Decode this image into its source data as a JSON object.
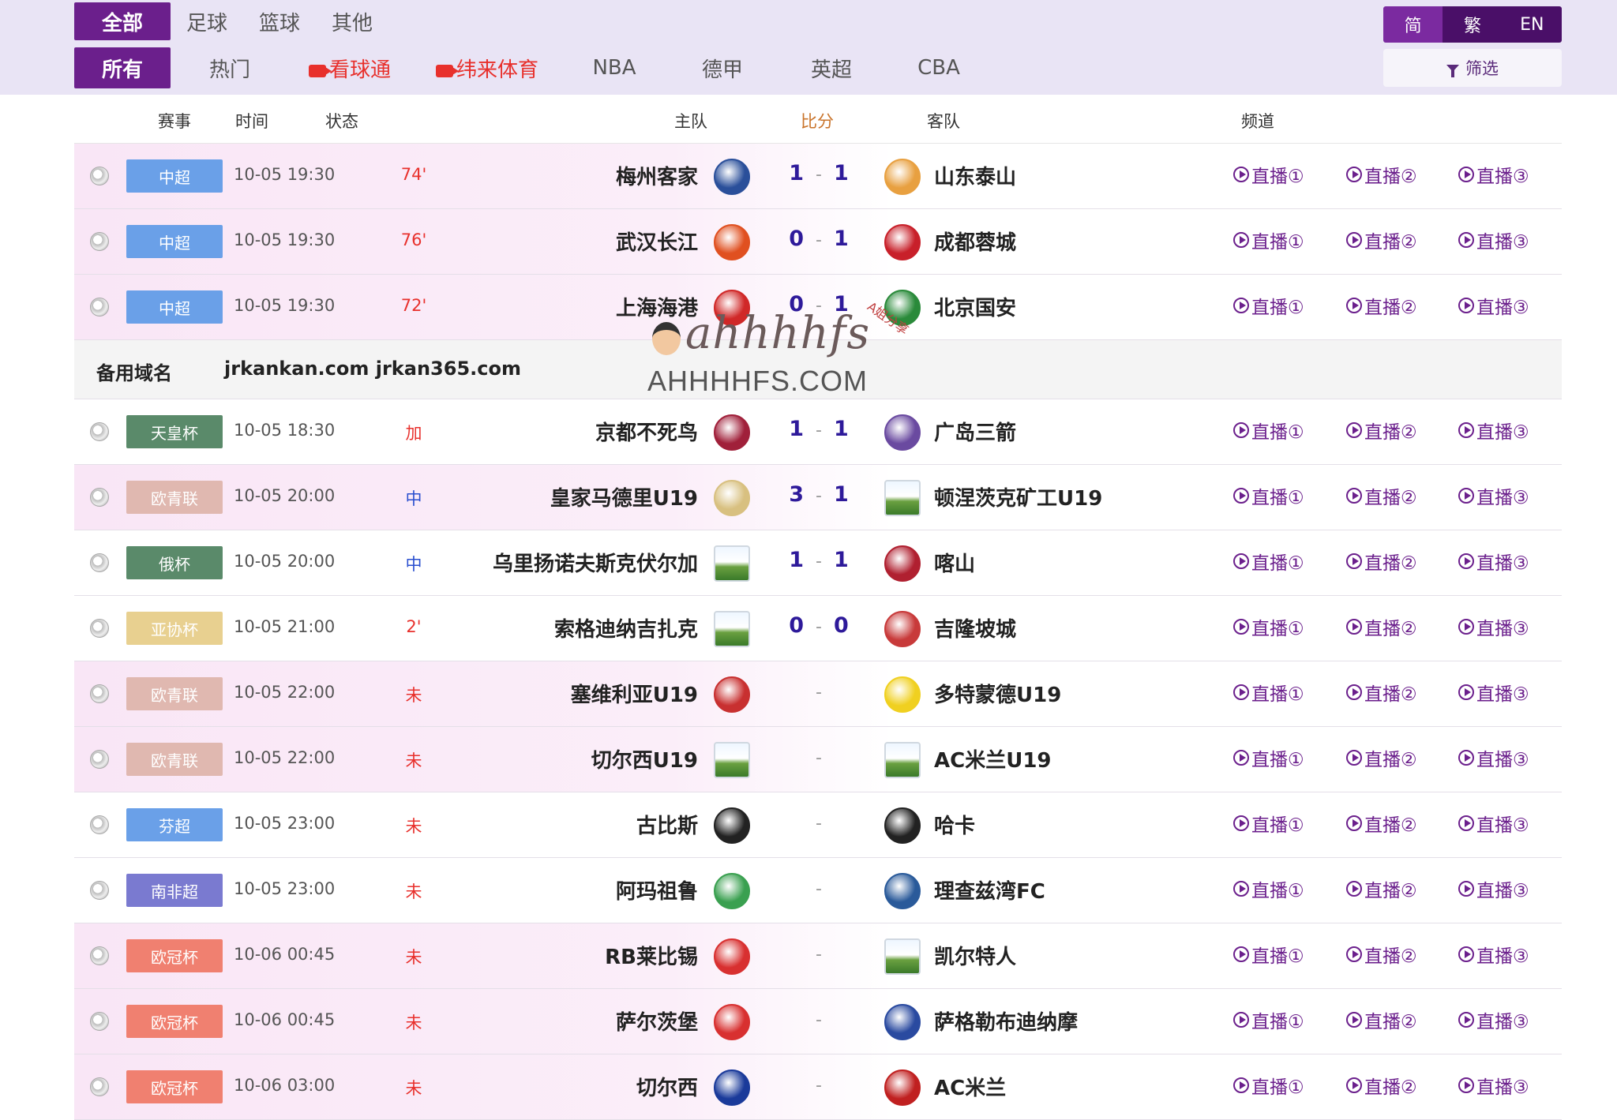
{
  "nav": {
    "row1": [
      "全部",
      "足球",
      "篮球",
      "其他"
    ],
    "row2": [
      "所有",
      "热门",
      "看球通",
      "纬来体育",
      "NBA",
      "德甲",
      "英超",
      "CBA"
    ]
  },
  "lang": [
    "简",
    "繁",
    "EN"
  ],
  "filter_label": "筛选",
  "headers": {
    "event": "赛事",
    "time": "时间",
    "status": "状态",
    "home": "主队",
    "score": "比分",
    "away": "客队",
    "channel": "频道"
  },
  "channels": [
    "直播①",
    "直播②",
    "直播③"
  ],
  "domain": {
    "label": "备用域名",
    "value": "jrkankan.com jrkan365.com"
  },
  "watermark": {
    "script": "ahhhhfs",
    "side": "A姐分享",
    "domain": "AHHHHFS.COM"
  },
  "matches": [
    {
      "league": "中超",
      "league_color": "#6aa0e8",
      "time": "10-05 19:30",
      "status": "74'",
      "status_color": "red",
      "home": "梅州客家",
      "home_badge": "#2a4f9a",
      "home_score": "1",
      "away_score": "1",
      "away": "山东泰山",
      "away_badge": "#e8a040"
    },
    {
      "league": "中超",
      "league_color": "#6aa0e8",
      "time": "10-05 19:30",
      "status": "76'",
      "status_color": "red",
      "home": "武汉长江",
      "home_badge": "#e05020",
      "home_score": "0",
      "away_score": "1",
      "away": "成都蓉城",
      "away_badge": "#c8202a"
    },
    {
      "league": "中超",
      "league_color": "#6aa0e8",
      "time": "10-05 19:30",
      "status": "72'",
      "status_color": "red",
      "home": "上海海港",
      "home_badge": "#d02828",
      "home_score": "0",
      "away_score": "1",
      "away": "北京国安",
      "away_badge": "#2a8a3a"
    },
    {
      "league": "天皇杯",
      "league_color": "#5a8a6a",
      "time": "10-05 18:30",
      "status": "加",
      "status_color": "red",
      "home": "京都不死鸟",
      "home_badge": "#a0203a",
      "home_score": "1",
      "away_score": "1",
      "away": "广岛三箭",
      "away_badge": "#6a4aa0"
    },
    {
      "league": "欧青联",
      "league_color": "#e0b8b0",
      "time": "10-05 20:00",
      "status": "中",
      "status_color": "blue",
      "home": "皇家马德里U19",
      "home_badge": "#d8c080",
      "home_score": "3",
      "away_score": "1",
      "away": "顿涅茨克矿工U19",
      "away_badge": "placeholder"
    },
    {
      "league": "俄杯",
      "league_color": "#5a8a6a",
      "time": "10-05 20:00",
      "status": "中",
      "status_color": "blue",
      "home": "乌里扬诺夫斯克伏尔加",
      "home_badge": "placeholder",
      "home_score": "1",
      "away_score": "1",
      "away": "喀山",
      "away_badge": "#b02030"
    },
    {
      "league": "亚协杯",
      "league_color": "#e8d090",
      "time": "10-05 21:00",
      "status": "2'",
      "status_color": "red",
      "home": "索格迪纳吉扎克",
      "home_badge": "placeholder",
      "home_score": "0",
      "away_score": "0",
      "away": "吉隆坡城",
      "away_badge": "#c83a3a"
    },
    {
      "league": "欧青联",
      "league_color": "#e0b8b0",
      "time": "10-05 22:00",
      "status": "未",
      "status_color": "red",
      "home": "塞维利亚U19",
      "home_badge": "#c83030",
      "home_score": "",
      "away_score": "",
      "away": "多特蒙德U19",
      "away_badge": "#f0d020"
    },
    {
      "league": "欧青联",
      "league_color": "#e0b8b0",
      "time": "10-05 22:00",
      "status": "未",
      "status_color": "red",
      "home": "切尔西U19",
      "home_badge": "placeholder",
      "home_score": "",
      "away_score": "",
      "away": "AC米兰U19",
      "away_badge": "placeholder"
    },
    {
      "league": "芬超",
      "league_color": "#6aa0e8",
      "time": "10-05 23:00",
      "status": "未",
      "status_color": "red",
      "home": "古比斯",
      "home_badge": "#222222",
      "home_score": "",
      "away_score": "",
      "away": "哈卡",
      "away_badge": "#222222"
    },
    {
      "league": "南非超",
      "league_color": "#7a7ad0",
      "time": "10-05 23:00",
      "status": "未",
      "status_color": "red",
      "home": "阿玛祖鲁",
      "home_badge": "#3aa050",
      "home_score": "",
      "away_score": "",
      "away": "理查兹湾FC",
      "away_badge": "#2a5a9a"
    },
    {
      "league": "欧冠杯",
      "league_color": "#f08070",
      "time": "10-06 00:45",
      "status": "未",
      "status_color": "red",
      "home": "RB莱比锡",
      "home_badge": "#d83030",
      "home_score": "",
      "away_score": "",
      "away": "凯尔特人",
      "away_badge": "placeholder"
    },
    {
      "league": "欧冠杯",
      "league_color": "#f08070",
      "time": "10-06 00:45",
      "status": "未",
      "status_color": "red",
      "home": "萨尔茨堡",
      "home_badge": "#d83030",
      "home_score": "",
      "away_score": "",
      "away": "萨格勒布迪纳摩",
      "away_badge": "#2a4aa0"
    },
    {
      "league": "欧冠杯",
      "league_color": "#f08070",
      "time": "10-06 03:00",
      "status": "未",
      "status_color": "red",
      "home": "切尔西",
      "home_badge": "#1a3a9a",
      "home_score": "",
      "away_score": "",
      "away": "AC米兰",
      "away_badge": "#c02020"
    }
  ]
}
